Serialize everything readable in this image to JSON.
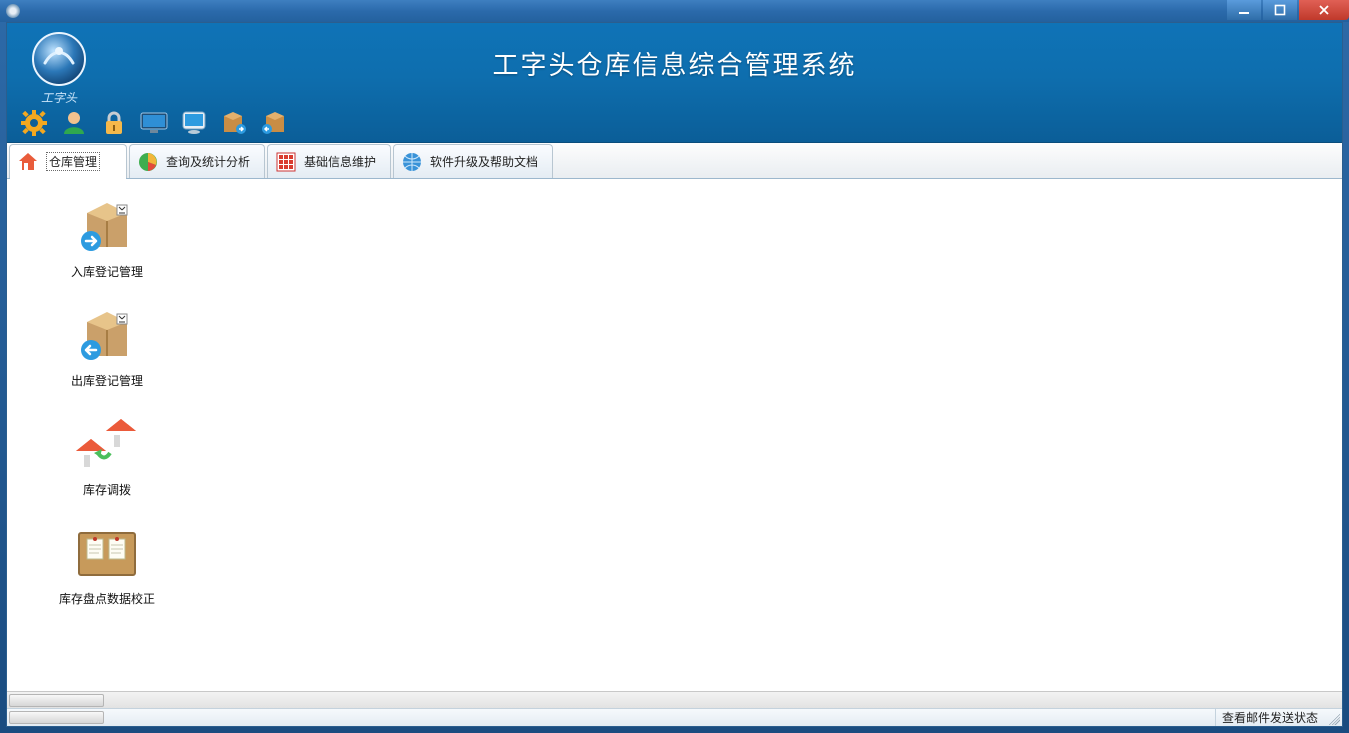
{
  "window": {
    "title": ""
  },
  "banner": {
    "title": "工字头仓库信息综合管理系统",
    "logo_caption": "工字头"
  },
  "toolbar_icons": [
    {
      "name": "settings-gear-icon"
    },
    {
      "name": "user-icon"
    },
    {
      "name": "lock-icon"
    },
    {
      "name": "monitor-icon"
    },
    {
      "name": "screen-display-icon"
    },
    {
      "name": "package-in-icon"
    },
    {
      "name": "package-out-icon"
    }
  ],
  "tabs": [
    {
      "label": "仓库管理",
      "icon": "house-icon",
      "active": true
    },
    {
      "label": "查询及统计分析",
      "icon": "pie-chart-icon",
      "active": false
    },
    {
      "label": "基础信息维护",
      "icon": "grid-settings-icon",
      "active": false
    },
    {
      "label": "软件升级及帮助文档",
      "icon": "globe-icon",
      "active": false
    }
  ],
  "nav_items": [
    {
      "label": "入库登记管理",
      "icon": "box-in-icon"
    },
    {
      "label": "出库登记管理",
      "icon": "box-out-icon"
    },
    {
      "label": "库存调拨",
      "icon": "house-transfer-icon"
    },
    {
      "label": "库存盘点数据校正",
      "icon": "corkboard-notes-icon"
    }
  ],
  "statusbar": {
    "mail_status_label": "查看邮件发送状态"
  },
  "colors": {
    "banner_top": "#0f73b7",
    "banner_bottom": "#0b5e98",
    "close_button": "#c0392b",
    "window_chrome": "#2e6da8"
  }
}
